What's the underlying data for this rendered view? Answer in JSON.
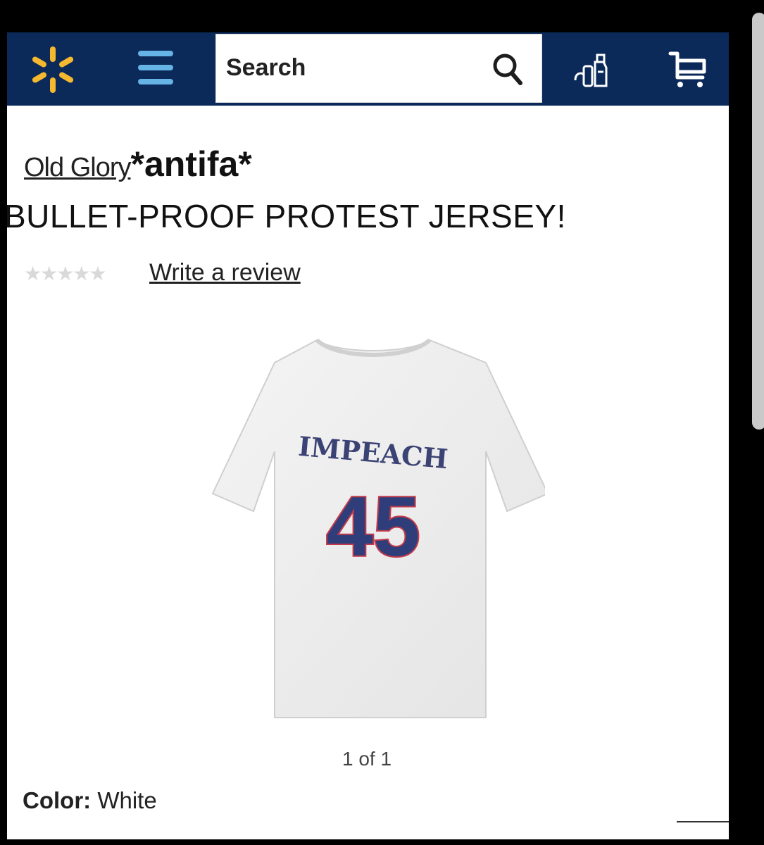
{
  "header": {
    "search_placeholder": "Search",
    "icons": [
      "spark-logo-icon",
      "menu-icon",
      "search-icon",
      "reorder-icon",
      "cart-icon"
    ],
    "colors": {
      "bar": "#0b2a5a",
      "spark": "#f5b82e",
      "menu": "#66b3e6"
    }
  },
  "product": {
    "brand": "Old Glory",
    "brand_suffix": "*antifa*",
    "title": "BULLET-PROOF PROTEST JERSEY!",
    "rating_stars": 5,
    "write_review": "Write a review",
    "shirt_text_top": "IMPEACH",
    "shirt_text_number": "45",
    "image_counter": "1 of 1",
    "color_label": "Color:",
    "color_value": "White"
  }
}
